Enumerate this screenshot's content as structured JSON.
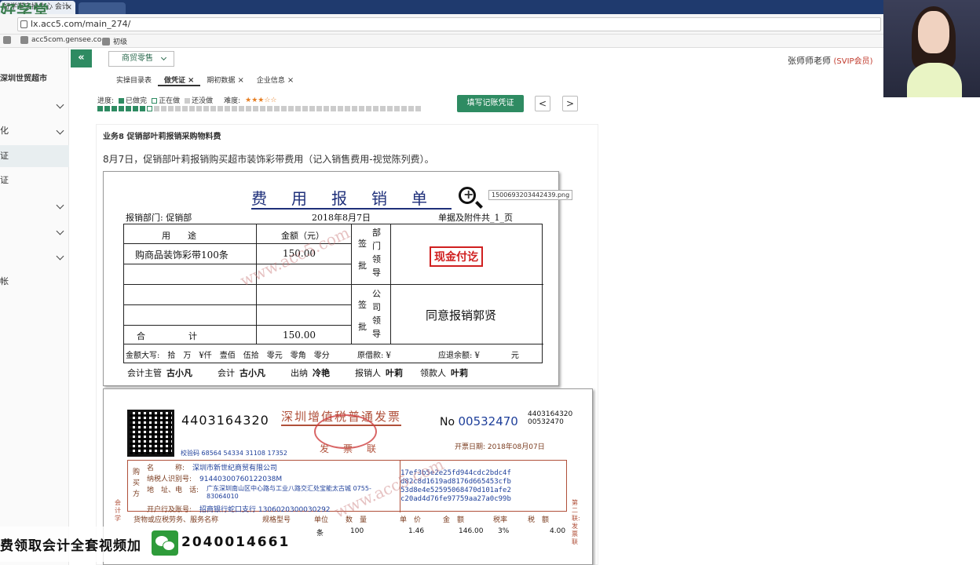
{
  "browser": {
    "tab_title": "好学堂实操中心 会计",
    "url": "lx.acc5.com/main_274/",
    "bookmarks": [
      "acc5com.gensee.co",
      "初级"
    ],
    "logo": "好学堂"
  },
  "sidebar": {
    "store": "深圳世贸超市",
    "items": [
      {
        "label": "",
        "expanded": false
      },
      {
        "label": "化",
        "expanded": false
      },
      {
        "label": "证",
        "active": true
      },
      {
        "label": "证"
      },
      {
        "label": "",
        "expanded": false
      },
      {
        "label": "",
        "expanded": false
      },
      {
        "label": "",
        "expanded": false
      },
      {
        "label": "帐"
      }
    ]
  },
  "header": {
    "collapse": "«",
    "product": "商贸零售",
    "teacher": "张师师老师",
    "vip": "(SVIP会员)"
  },
  "tabs": [
    {
      "label": "实操目录表",
      "closable": false
    },
    {
      "label": "做凭证",
      "closable": true,
      "active": true
    },
    {
      "label": "期初数据",
      "closable": true
    },
    {
      "label": "企业信息",
      "closable": true
    }
  ],
  "progress": {
    "label": "进度:",
    "done": "已做完",
    "doing": "正在做",
    "todo": "还没做",
    "difficulty_label": "难度:",
    "difficulty_stars": "★★★☆☆",
    "done_count": 7,
    "current_index": 7,
    "total": 46
  },
  "actions": {
    "fill_voucher": "填写记账凭证",
    "prev": "<",
    "next": ">"
  },
  "business": {
    "title": "业务8 促销部叶莉报销采购物料费",
    "desc": "8月7日，促销部叶莉报销购买超市装饰彩带费用（记入销售费用-视觉陈列费）。"
  },
  "expense_form": {
    "title": "费用报销单",
    "dept": "报销部门: 促销部",
    "date": "2018年8月7日",
    "attachments": "单据及附件共_1_页",
    "col_use": "用　　途",
    "col_amount": "金额（元）",
    "dept_approve": [
      "签",
      "批"
    ],
    "dept_leader": [
      "部",
      "门",
      "领",
      "导"
    ],
    "company_leader": [
      "公",
      "司",
      "领",
      "导"
    ],
    "item": "购商品装饰彩带100条",
    "item_amount": "150.00",
    "total_label": "合　　　　　计",
    "total_amount": "150.00",
    "stamp": "现金付讫",
    "approve_text": "同意报销郭贤",
    "capital": "金额大写:　拾　万　¥仟　壹佰　伍拾　零元　零角　零分",
    "borrowed": "原借款: ¥",
    "refund": "应退余额: ¥　　　　元",
    "sig_labels": [
      "会计主管",
      "会计",
      "出纳",
      "报销人",
      "领款人"
    ],
    "sig_names": [
      "古小凡",
      "古小凡",
      "冷艳",
      "叶莉",
      "叶莉"
    ],
    "tooltip": "1500693203442439.png"
  },
  "invoice": {
    "code": "4403164320",
    "title": "深圳增值税普通发票",
    "no_label": "No",
    "number": "00532470",
    "code_small": "4403164320",
    "number_small": "00532470",
    "sub": "发　票　联",
    "check_code": "校验码 68564 54334 31108 17352",
    "date": "开票日期: 2018年08月07日",
    "buyer_side": [
      "购",
      "买",
      "方"
    ],
    "fields": [
      {
        "label": "名　　　称:",
        "value": "深圳市新世纪商贸有限公司"
      },
      {
        "label": "纳税人识别号:",
        "value": "91440300760122038M"
      },
      {
        "label": "地　址、电　话:",
        "value": "广东深圳南山区中心路与工业八路交汇处宝能太古城 0755-83064010"
      },
      {
        "label": "开户行及账号:",
        "value": "招商银行蛇口支行 1306020300030292"
      }
    ],
    "cipher": [
      "17ef3b5e2e25fd944cdc2bdc4f",
      "d82c8d1619ad8176d665453cfb",
      "53d8e4e52595068470d101afe2",
      "c20ad4d76fe97759aa27a0c99b"
    ],
    "goods_headers": [
      "货物或应税劳务、服务名称",
      "规格型号",
      "单位",
      "数　量",
      "单　价",
      "金　额",
      "税率",
      "税　额"
    ],
    "goods": {
      "unit": "条",
      "qty": "100",
      "price": "1.46",
      "amount": "146.00",
      "rate": "3%",
      "tax": "4.00"
    },
    "side_right": "第二联:发票联",
    "side_left": "会计学"
  },
  "watermark": "www.acc5.com",
  "promo": {
    "text": "加我微信领取会计全套视频",
    "visible_text": "费领取会计全套视频加",
    "number": "2040014661"
  }
}
